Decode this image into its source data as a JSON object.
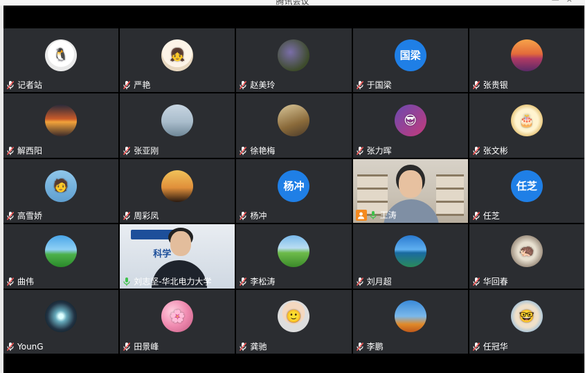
{
  "window": {
    "title": "腾讯会议",
    "controls": [
      "—",
      "×"
    ]
  },
  "colors": {
    "muted_mic": "#ff5a5a",
    "active_mic": "#3ec24b",
    "text_avatar": "#1f7fe6",
    "host_badge": "#f58a1f"
  },
  "participants": [
    {
      "name": "记者站",
      "avatar": "penguin",
      "mic": "muted"
    },
    {
      "name": "严艳",
      "avatar": "cartoon-girl",
      "mic": "muted"
    },
    {
      "name": "赵美玲",
      "avatar": "berries",
      "mic": "muted"
    },
    {
      "name": "于国梁",
      "avatar_text": "国梁",
      "mic": "muted"
    },
    {
      "name": "张贵银",
      "avatar": "sunset-field",
      "mic": "muted"
    },
    {
      "name": "解西阳",
      "avatar": "sunset-sea",
      "mic": "muted"
    },
    {
      "name": "张亚刚",
      "avatar": "sea-sky",
      "mic": "muted"
    },
    {
      "name": "徐艳梅",
      "avatar": "painting",
      "mic": "muted"
    },
    {
      "name": "张力晖",
      "avatar": "man-sunglasses",
      "mic": "muted"
    },
    {
      "name": "张文彬",
      "avatar": "cake",
      "mic": "muted"
    },
    {
      "name": "高雪娇",
      "avatar": "anime-boy",
      "mic": "muted"
    },
    {
      "name": "周彩凤",
      "avatar": "silhouette",
      "mic": "muted"
    },
    {
      "name": "杨冲",
      "avatar_text": "杨冲",
      "mic": "muted"
    },
    {
      "name": "王涛",
      "video": "man-bookshelf",
      "mic": "active",
      "host": true
    },
    {
      "name": "任芝",
      "avatar_text": "任芝",
      "mic": "muted"
    },
    {
      "name": "曲伟",
      "avatar": "green-meadow",
      "mic": "muted"
    },
    {
      "name": "刘志坚-华北电力大学",
      "video": "man-banner",
      "mic": "active",
      "speaking": true,
      "banner_text": "科学"
    },
    {
      "name": "李松涛",
      "avatar": "hills",
      "mic": "muted"
    },
    {
      "name": "刘月超",
      "avatar": "lake",
      "mic": "muted"
    },
    {
      "name": "华回春",
      "avatar": "hedgehog",
      "mic": "muted"
    },
    {
      "name": "YounG",
      "avatar": "galaxy",
      "mic": "muted"
    },
    {
      "name": "田景峰",
      "avatar": "blossoms",
      "mic": "muted"
    },
    {
      "name": "龚驰",
      "avatar": "man-glasses",
      "mic": "muted"
    },
    {
      "name": "李鹏",
      "avatar": "autumn-sky",
      "mic": "muted"
    },
    {
      "name": "任冠华",
      "avatar": "cartoon-man",
      "mic": "muted"
    }
  ]
}
